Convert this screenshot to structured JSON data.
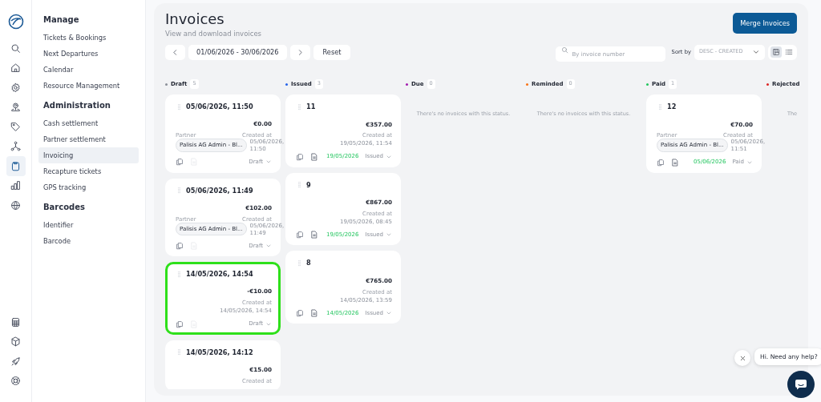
{
  "rail": [
    {
      "selected": false
    },
    {
      "selected": false
    },
    {
      "selected": false
    },
    {
      "selected": false
    },
    {
      "selected": false
    },
    {
      "selected": false
    },
    {
      "selected": true
    },
    {
      "selected": false
    },
    {
      "selected": false
    }
  ],
  "sidebar": {
    "sections": [
      {
        "title": "Manage",
        "items": [
          {
            "label": "Tickets & Bookings",
            "selected": false
          },
          {
            "label": "Next Departures",
            "selected": false
          },
          {
            "label": "Calendar",
            "selected": false
          },
          {
            "label": "Resource Management",
            "selected": false
          }
        ]
      },
      {
        "title": "Administration",
        "items": [
          {
            "label": "Cash settlement",
            "selected": false
          },
          {
            "label": "Partner settlement",
            "selected": false
          },
          {
            "label": "Invoicing",
            "selected": true
          },
          {
            "label": "Recapture tickets",
            "selected": false
          },
          {
            "label": "GPS tracking",
            "selected": false
          }
        ]
      },
      {
        "title": "Barcodes",
        "items": [
          {
            "label": "Identifier",
            "selected": false
          },
          {
            "label": "Barcode",
            "selected": false
          }
        ]
      }
    ]
  },
  "header": {
    "title": "Invoices",
    "subtitle": "View and download invoices",
    "merge_button": "Merge Invoices",
    "date_range": "01/06/2026 - 30/06/2026",
    "reset_button": "Reset",
    "search": {
      "placeholder": "By invoice number"
    },
    "sort_label": "Sort by",
    "sort_value": "DESC - CREATED",
    "views": [
      {
        "selected": true
      },
      {
        "selected": false
      }
    ]
  },
  "columns": [
    {
      "name": "Draft",
      "count": "5",
      "color": "#8a8f98",
      "cards": [
        {
          "title": "05/06/2026, 11:50",
          "amount": "€0.00",
          "partner_label": "Partner",
          "partner": "Palisis AG Admin - Bl...",
          "created_label": "Created at",
          "created": "05/06/2026, 11:50",
          "doc_enabled": false,
          "status": "Draft",
          "selected": false
        },
        {
          "title": "05/06/2026, 11:49",
          "amount": "€102.00",
          "partner_label": "Partner",
          "partner": "Palisis AG Admin - Bl...",
          "created_label": "Created at",
          "created": "05/06/2026, 11:49",
          "doc_enabled": false,
          "status": "Draft",
          "selected": false
        },
        {
          "title": "14/05/2026, 14:54",
          "amount": "-€10.00",
          "created_label": "Created at",
          "created": "14/05/2026, 14:54",
          "doc_enabled": false,
          "status": "Draft",
          "selected": true
        },
        {
          "title": "14/05/2026, 14:12",
          "amount": "€15.00",
          "created_label": "Created at",
          "selected": false
        }
      ]
    },
    {
      "name": "Issued",
      "count": "3",
      "color": "#2563eb",
      "cards": [
        {
          "title": "11",
          "amount": "€357.00",
          "created_label": "Created at",
          "created": "19/05/2026, 11:54",
          "doc_enabled": true,
          "paid_date": "19/05/2026",
          "status": "Issued",
          "selected": false
        },
        {
          "title": "9",
          "amount": "€867.00",
          "created_label": "Created at",
          "created": "19/05/2026, 08:45",
          "doc_enabled": true,
          "paid_date": "19/05/2026",
          "status": "Issued",
          "selected": false
        },
        {
          "title": "8",
          "amount": "€765.00",
          "created_label": "Created at",
          "created": "14/05/2026, 13:59",
          "doc_enabled": true,
          "paid_date": "14/05/2026",
          "status": "Issued",
          "selected": false
        }
      ]
    },
    {
      "name": "Due",
      "count": "0",
      "color": "#a21caf",
      "empty_text": "There's no invoices with this status."
    },
    {
      "name": "Reminded",
      "count": "0",
      "color": "#f97316",
      "empty_text": "There's no invoices with this status."
    },
    {
      "name": "Paid",
      "count": "1",
      "color": "#22c55e",
      "cards": [
        {
          "title": "12",
          "amount": "€70.00",
          "partner_label": "Partner",
          "partner": "Palisis AG Admin - Bl...",
          "created_label": "Created at",
          "created": "05/06/2026, 11:51",
          "doc_enabled": true,
          "paid_date": "05/06/2026",
          "status": "Paid",
          "selected": false
        }
      ]
    },
    {
      "name": "Rejected",
      "color": "#dc2626",
      "empty_text": "The"
    }
  ],
  "chat": {
    "message": "Hi. Need any help?"
  }
}
